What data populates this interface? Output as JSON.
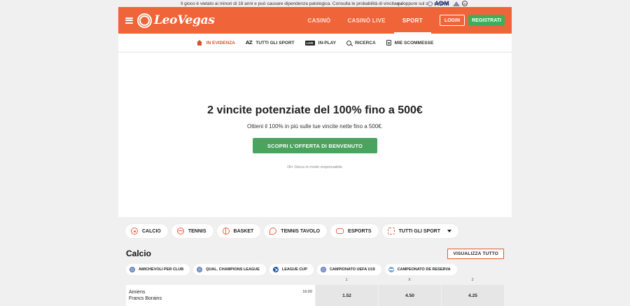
{
  "disclaimer": {
    "text_before": "Il gioco è vietato ai minori di 18 anni e può causare dipendenza patologica. Consulta le probabilità di vincita ",
    "link": "qui",
    "text_middle": " oppure sul sito di ",
    "bold_end": "ADM",
    "text_end": ".",
    "adm_logo": "ADM",
    "age_badge": "18+"
  },
  "header": {
    "brand": "LeoVegas",
    "nav": [
      {
        "label": "CASINÒ"
      },
      {
        "label": "CASINÒ LIVE"
      },
      {
        "label": "SPORT"
      }
    ],
    "login_label": "LOGIN",
    "register_label": "REGISTRATI",
    "accent": "#f0643a"
  },
  "subnav": [
    {
      "label": "IN EVIDENZA",
      "icon": "home-icon"
    },
    {
      "label": "TUTTI GLI SPORT",
      "icon": "az-icon",
      "icon_text": "AZ"
    },
    {
      "label": "IN-PLAY",
      "icon": "live-icon",
      "icon_text": "LIVE"
    },
    {
      "label": "RICERCA",
      "icon": "search-icon"
    },
    {
      "label": "MIE SCOMMESSE",
      "icon": "betslip-icon"
    }
  ],
  "hero": {
    "title": "2 vincite potenziate del 100% fino a 500€",
    "subtitle": "Ottieni il 100% in più sulle tue vincite nette fino a 500€.",
    "cta": "SCOPRI L'OFFERTA DI BENVENUTO",
    "note": "18+ Gioca in modo responsabile.",
    "cta_color": "#4aa35f"
  },
  "sports": [
    {
      "label": "CALCIO",
      "icon": "football-icon"
    },
    {
      "label": "TENNIS",
      "icon": "tennis-icon"
    },
    {
      "label": "BASKET",
      "icon": "basketball-icon"
    },
    {
      "label": "TENNIS TAVOLO",
      "icon": "table-tennis-icon"
    },
    {
      "label": "ESPORTS",
      "icon": "esports-icon"
    },
    {
      "label": "TUTTI GLI SPORT",
      "icon": "all-sports-icon"
    }
  ],
  "section": {
    "title": "Calcio",
    "view_all": "VISUALIZZA TUTTO"
  },
  "competitions": [
    {
      "label": "AMICHEVOLI PER CLUB",
      "icon": "globe-icon"
    },
    {
      "label": "QUAL. CHAMPIONS LEAGUE",
      "icon": "globe-icon"
    },
    {
      "label": "LEAGUE CUP",
      "icon": "scotland-flag-icon"
    },
    {
      "label": "CAMPIONATO UEFA U19",
      "icon": "globe-icon"
    },
    {
      "label": "CAMPEONATO DE RESERVA",
      "icon": "argentina-flag-icon"
    }
  ],
  "odds_headers": [
    "1",
    "X",
    "2"
  ],
  "match": {
    "home": "Amiens",
    "away": "Francs Borains",
    "time": "16:00",
    "odds": [
      "1.52",
      "4.50",
      "4.25"
    ]
  }
}
